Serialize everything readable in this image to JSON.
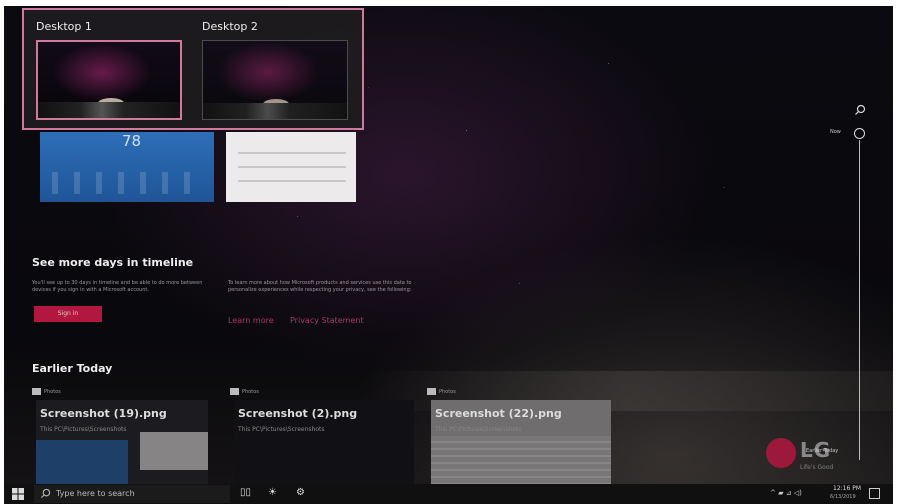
{
  "desktops": [
    {
      "label": "Desktop 1"
    },
    {
      "label": "Desktop 2"
    }
  ],
  "timeline_thumbs": {
    "weather_temp": "78"
  },
  "see_more": {
    "heading": "See more days in timeline",
    "left_text": "You'll see up to 30 days in timeline and be able to do more between devices if you sign in with a Microsoft account.",
    "right_text": "To learn more about how Microsoft products and services use this data to personalize experiences while respecting your privacy, see the following:",
    "sign_in": "Sign in",
    "learn_more": "Learn more",
    "privacy": "Privacy Statement"
  },
  "earlier_today": {
    "heading": "Earlier Today",
    "cards": [
      {
        "app": "Photos",
        "title": "Screenshot (19).png",
        "path": "This PC\\Pictures\\Screenshots"
      },
      {
        "app": "Photos",
        "title": "Screenshot (2).png",
        "path": "This PC\\Pictures\\Screenshots"
      },
      {
        "app": "Photos",
        "title": "Screenshot (22).png",
        "path": "This PC\\Pictures\\Screenshots"
      }
    ]
  },
  "rail": {
    "now": "Now",
    "earlier": "Earlier Today"
  },
  "brand": {
    "logo": "LG",
    "slogan": "Life's Good",
    "accent": "#b1173f",
    "highlight": "#d07a9b"
  },
  "taskbar": {
    "search_placeholder": "Type here to search",
    "time": "12:16 PM",
    "date": "6/13/2019",
    "tray": "^ ▰ ⊿ ◁)"
  }
}
